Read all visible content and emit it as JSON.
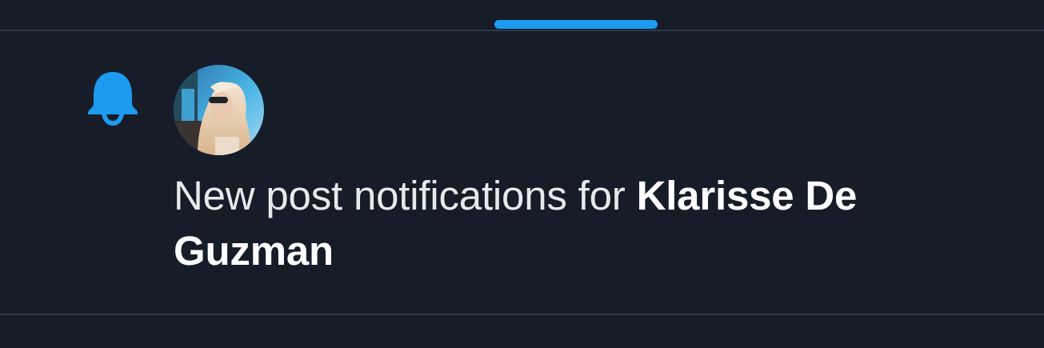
{
  "colors": {
    "background": "#161d29",
    "accent": "#1d9bf0",
    "divider": "#2f3a48",
    "text": "#e7e9ea"
  },
  "notification": {
    "icon": "bell-icon",
    "avatar_icon": "user-avatar",
    "message_prefix": "New post notifications for",
    "user_name": "Klarisse De Guzman"
  }
}
